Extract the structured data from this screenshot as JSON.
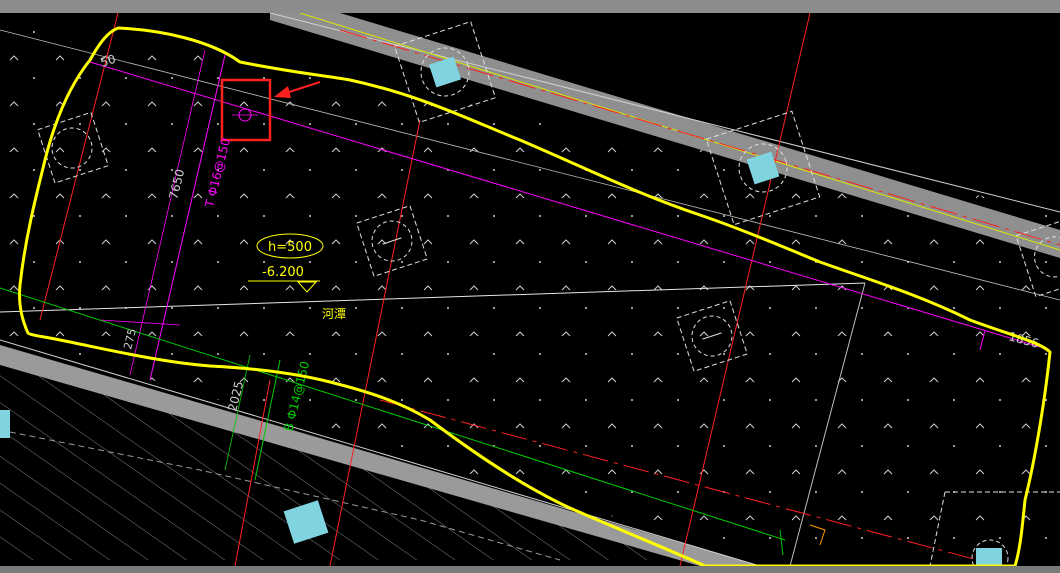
{
  "drawing": {
    "elevation_tag": "h=500",
    "level": "-6.200",
    "zone_label": "河潭",
    "dim_top_left": "50",
    "dim_vertical": "7650",
    "rebar_vertical": "T Φ16@150",
    "dim_small": "275",
    "dim_lower": "2025",
    "rebar_lower": "B Φ14@150",
    "dim_right": "1856"
  },
  "colors": {
    "background": "#000000",
    "boundary_markup": "#ffff00",
    "highlight_box": "#ff2020",
    "rebar_magenta": "#ff00ff",
    "rebar_green": "#00cc00",
    "axis_red": "#ff2020",
    "wall_gray": "#9a9a9a",
    "column_cyan": "#7fd4e0"
  },
  "icons": {
    "pointer": "red-arrow-icon",
    "level_mark": "level-triangle-icon"
  }
}
